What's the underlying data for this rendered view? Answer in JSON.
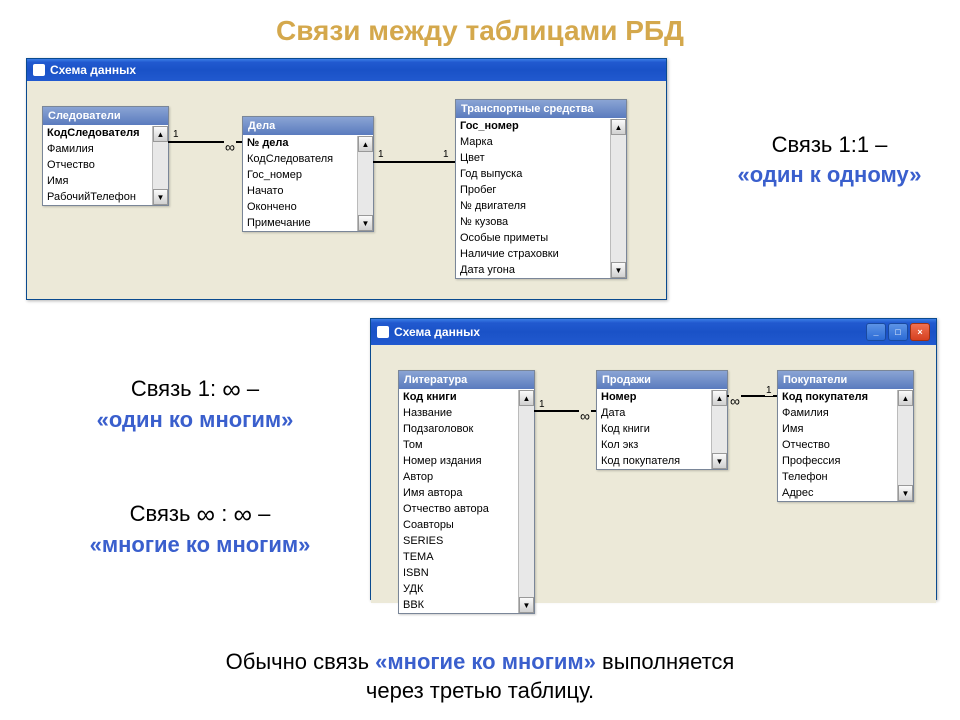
{
  "page_title": "Связи между таблицами РБД",
  "infinity": "∞",
  "schema_windows": [
    {
      "title": "Схема данных",
      "has_buttons": false
    },
    {
      "title": "Схема данных",
      "has_buttons": true
    }
  ],
  "win_buttons": {
    "min": "_",
    "max": "□",
    "close": "×"
  },
  "schema1": {
    "tables": [
      {
        "title": "Следователи",
        "fields": [
          "КодСледователя",
          "Фамилия",
          "Отчество",
          "Имя",
          "РабочийТелефон"
        ],
        "pk_idx": 0
      },
      {
        "title": "Дела",
        "fields": [
          "№ дела",
          "КодСледователя",
          "Гос_номер",
          "Начато",
          "Окончено",
          "Примечание"
        ],
        "pk_idx": 0
      },
      {
        "title": "Транспортные средства",
        "fields": [
          "Гос_номер",
          "Марка",
          "Цвет",
          "Год выпуска",
          "Пробег",
          "№ двигателя",
          "№ кузова",
          "Особые приметы",
          "Наличие страховки",
          "Дата угона"
        ],
        "pk_idx": 0
      }
    ],
    "conns": [
      {
        "from_side_label": "1",
        "to_side_label": "∞"
      },
      {
        "from_side_label": "1",
        "to_side_label": "1"
      }
    ]
  },
  "schema2": {
    "tables": [
      {
        "title": "Литература",
        "fields": [
          "Код книги",
          "Название",
          "Подзаголовок",
          "Том",
          "Номер издания",
          "Автор",
          "Имя автора",
          "Отчество автора",
          "Соавторы",
          "SERIES",
          "ТЕМА",
          "ISBN",
          "УДК",
          "ВВК"
        ],
        "pk_idx": 0
      },
      {
        "title": "Продажи",
        "fields": [
          "Номер",
          "Дата",
          "Код книги",
          "Кол экз",
          "Код покупателя"
        ],
        "pk_idx": 0
      },
      {
        "title": "Покупатели",
        "fields": [
          "Код покупателя",
          "Фамилия",
          "Имя",
          "Отчество",
          "Профессия",
          "Телефон",
          "Адрес"
        ],
        "pk_idx": 0
      }
    ],
    "conns": [
      {
        "from_side_label": "1",
        "to_side_label": "∞"
      },
      {
        "from_side_label": "∞",
        "to_side_label": "1"
      }
    ]
  },
  "texts": {
    "t1_a": "Связь 1:1 –",
    "t1_b": "«один к одному»",
    "t2_a": "Связь 1:",
    "t2_b": "–",
    "t2_c": "«один ко многим»",
    "t3_a": "Связь",
    "t3_b": ":",
    "t3_c": "–",
    "t3_d": "«многие ко многим»",
    "footer_a": "Обычно связь ",
    "footer_b": "«многие ко многим»",
    "footer_c": " выполняется",
    "footer_d": "через третью таблицу."
  }
}
